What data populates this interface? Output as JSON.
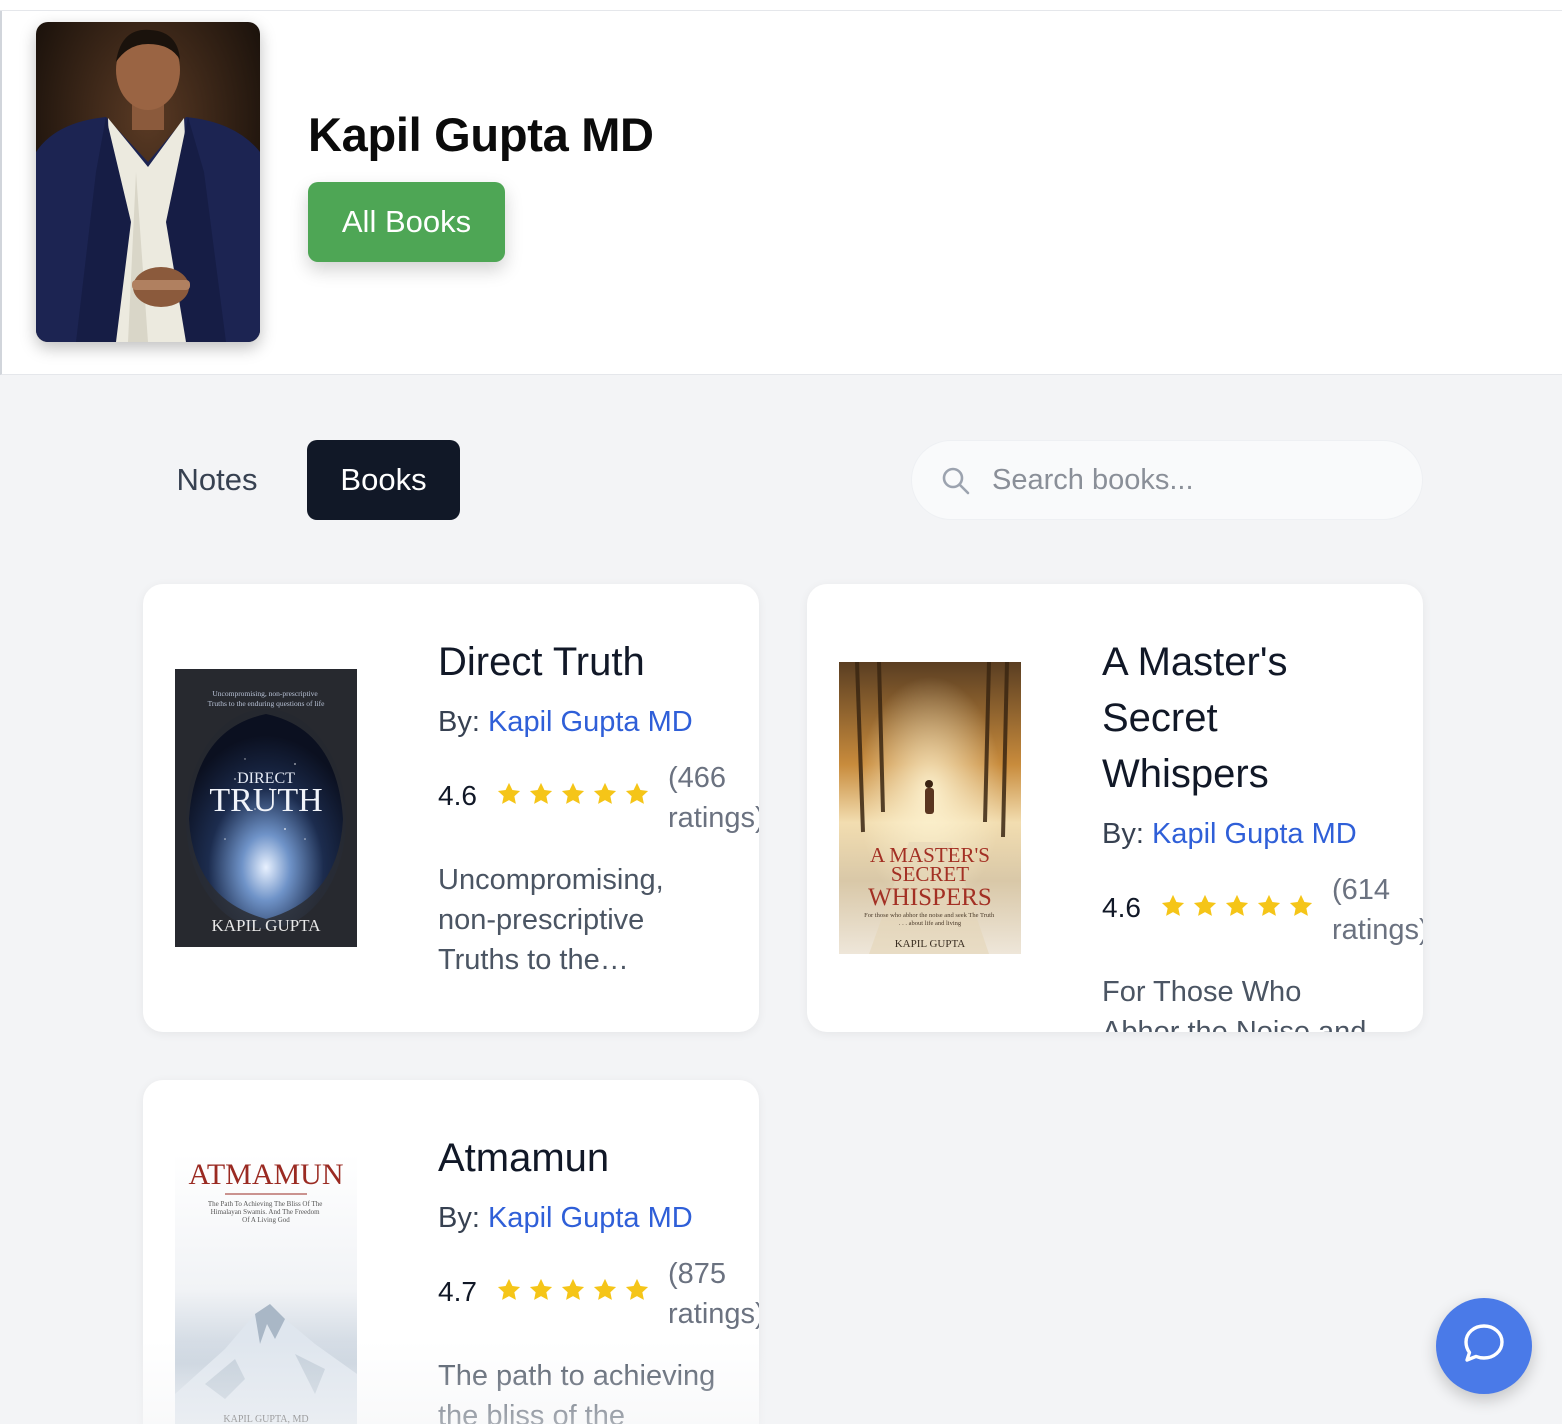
{
  "author": {
    "name": "Kapil Gupta MD",
    "all_books_label": "All Books"
  },
  "tabs": [
    {
      "label": "Notes",
      "active": false
    },
    {
      "label": "Books",
      "active": true
    }
  ],
  "search": {
    "placeholder": "Search books...",
    "value": ""
  },
  "books": [
    {
      "title": "Direct Truth",
      "by_label": "By:",
      "author": "Kapil Gupta MD",
      "rating": "4.6",
      "stars": 5,
      "ratings_count": "(466 ratings)",
      "description": "Uncompromising, non-prescriptive Truths to the enduring questions of life",
      "cover": {
        "tagline": "Uncompromising, non-prescriptive Truths to the enduring questions of life",
        "title_line1": "DIRECT",
        "title_line2": "TRUTH",
        "author": "KAPIL GUPTA"
      }
    },
    {
      "title": "A Master's Secret Whispers",
      "by_label": "By:",
      "author": "Kapil Gupta MD",
      "rating": "4.6",
      "stars": 5,
      "ratings_count": "(614 ratings)",
      "description": "For Those Who Abhor the Noise and Seek The Truth",
      "cover": {
        "title_line1": "A MASTER'S",
        "title_line2": "SECRET",
        "title_line3": "WHISPERS",
        "tagline": "For those who abhor the noise and seek The Truth . . . about life and living",
        "author": "KAPIL GUPTA"
      }
    },
    {
      "title": "Atmamun",
      "by_label": "By:",
      "author": "Kapil Gupta MD",
      "rating": "4.7",
      "stars": 5,
      "ratings_count": "(875 ratings)",
      "description": "The path to achieving the bliss of the Himalayan Swamis",
      "cover": {
        "title": "ATMAMUN",
        "tagline": "The Path To Achieving The Bliss Of The Himalayan Swamis. And The Freedom Of A Living God",
        "author": "KAPIL GUPTA, MD"
      }
    }
  ],
  "colors": {
    "accent_green": "#4ea655",
    "active_tab": "#111827",
    "link": "#2f5fd8",
    "star": "#f5c518",
    "chat_button": "#4a7ae8"
  },
  "icons": {
    "search": "search-icon",
    "star": "star-icon",
    "chat": "chat-bubble-icon"
  }
}
